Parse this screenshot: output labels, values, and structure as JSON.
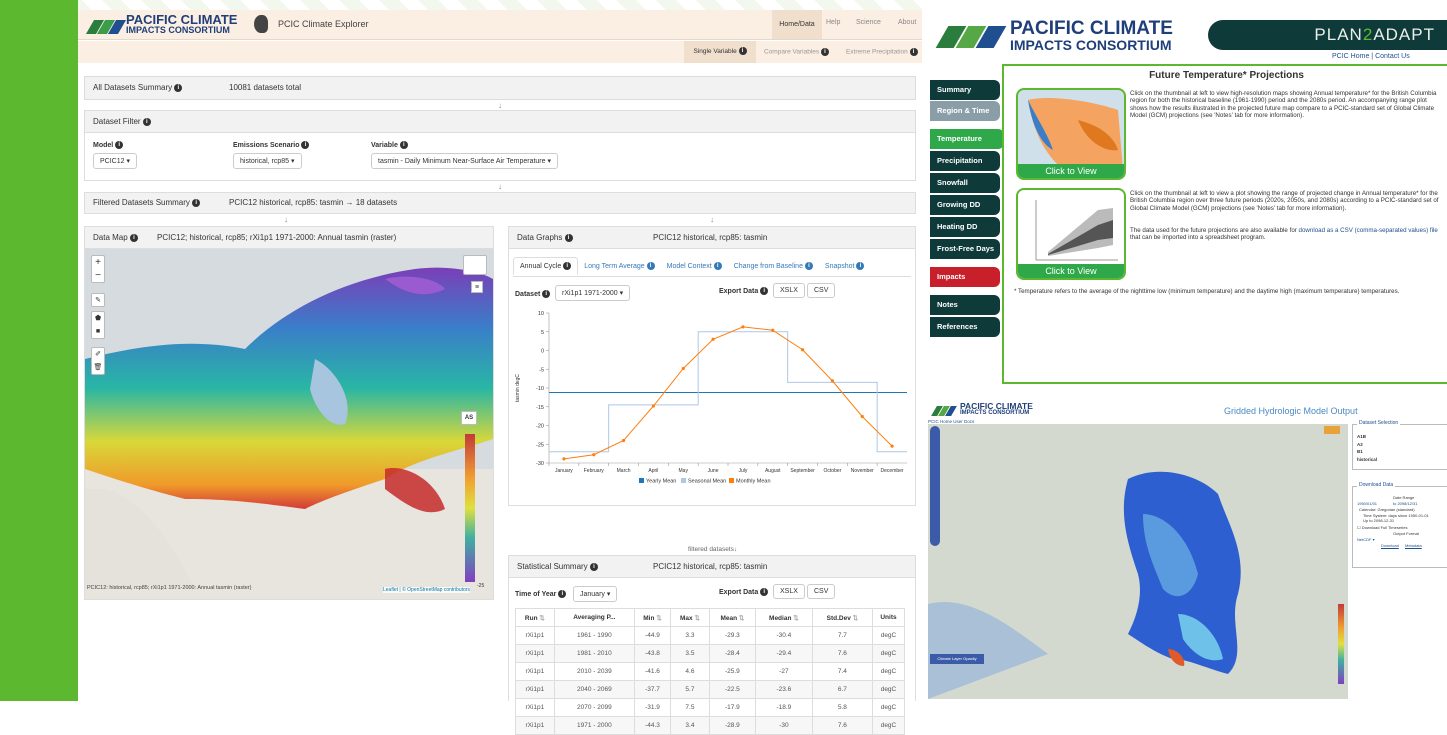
{
  "explorer": {
    "logo_line1": "PACIFIC CLIMATE",
    "logo_line2": "IMPACTS CONSORTIUM",
    "app_title": "PCIC Climate Explorer",
    "nav": [
      "Home/Data",
      "Help",
      "Science",
      "About"
    ],
    "subnav": [
      "Single Variable",
      "Compare Variables",
      "Extreme Precipitation"
    ],
    "summary_label": "All Datasets Summary",
    "summary_count": "10081 datasets total",
    "filter_label": "Dataset Filter",
    "model_label": "Model",
    "model_value": "PCIC12",
    "scenario_label": "Emissions Scenario",
    "scenario_value": "historical, rcp85",
    "variable_label": "Variable",
    "variable_value": "tasmin - Daily Minimum Near-Surface Air Temperature",
    "filtered_label": "Filtered Datasets Summary",
    "filtered_value": "PCIC12 historical, rcp85: tasmin → 18 datasets",
    "map_label": "Data Map",
    "map_title": "PCIC12; historical, rcp85; rXi1p1 1971-2000: Annual tasmin (raster)",
    "map_footer": "PCIC12: historical, rcp85; rXi1p1 1971-2000: Annual tasmin (raster)",
    "map_attrib": "Leaflet | © OpenStreetMap contributors",
    "map_as": "AS",
    "map_scale_bottom": "-25",
    "graphs_label": "Data Graphs",
    "graphs_title": "PCIC12 historical, rcp85: tasmin",
    "graph_tabs": [
      "Annual Cycle",
      "Long Term Average",
      "Model Context",
      "Change from Baseline",
      "Snapshot"
    ],
    "dataset_label": "Dataset",
    "dataset_value": "rXi1p1 1971-2000",
    "export_label": "Export Data",
    "export_xlsx": "XSLX",
    "export_csv": "CSV",
    "filtered_datasets_note": "filtered datasets",
    "stats_label": "Statistical Summary",
    "stats_title": "PCIC12 historical, rcp85: tasmin",
    "time_label": "Time of Year",
    "time_value": "January",
    "table_headers": [
      "Run",
      "Averaging P...",
      "Min",
      "Max",
      "Mean",
      "Median",
      "Std.Dev",
      "Units"
    ],
    "table_rows": [
      [
        "rXi1p1",
        "1961 - 1990",
        "-44.9",
        "3.3",
        "-29.3",
        "-30.4",
        "7.7",
        "degC"
      ],
      [
        "rXi1p1",
        "1981 - 2010",
        "-43.8",
        "3.5",
        "-28.4",
        "-29.4",
        "7.6",
        "degC"
      ],
      [
        "rXi1p1",
        "2010 - 2039",
        "-41.6",
        "4.6",
        "-25.9",
        "-27",
        "7.4",
        "degC"
      ],
      [
        "rXi1p1",
        "2040 - 2069",
        "-37.7",
        "5.7",
        "-22.5",
        "-23.6",
        "6.7",
        "degC"
      ],
      [
        "rXi1p1",
        "2070 - 2099",
        "-31.9",
        "7.5",
        "-17.9",
        "-18.9",
        "5.8",
        "degC"
      ],
      [
        "rXi1p1",
        "1971 - 2000",
        "-44.3",
        "3.4",
        "-28.9",
        "-30",
        "7.6",
        "degC"
      ]
    ]
  },
  "chart_data": {
    "type": "line",
    "ylabel": "tasmin degC",
    "ylim": [
      -30,
      10
    ],
    "yticks": [
      "10",
      "5",
      "0",
      "-5",
      "-10",
      "-15",
      "-20",
      "-25",
      "-30"
    ],
    "categories": [
      "January",
      "February",
      "March",
      "April",
      "May",
      "June",
      "July",
      "August",
      "September",
      "October",
      "November",
      "December"
    ],
    "series": [
      {
        "name": "Yearly Mean",
        "color": "#1f77b4",
        "values": [
          -11.2,
          -11.2,
          -11.2,
          -11.2,
          -11.2,
          -11.2,
          -11.2,
          -11.2,
          -11.2,
          -11.2,
          -11.2,
          -11.2
        ]
      },
      {
        "name": "Seasonal Mean",
        "color": "#aec7e8",
        "values": [
          -27.0,
          -27.0,
          -14.5,
          -14.5,
          -14.5,
          5.0,
          5.0,
          5.0,
          -8.5,
          -8.5,
          -8.5,
          -27.0
        ]
      },
      {
        "name": "Monthly Mean",
        "color": "#ff7f0e",
        "values": [
          -28.9,
          -27.8,
          -24.0,
          -14.8,
          -4.8,
          3.0,
          6.3,
          5.4,
          0.2,
          -8.1,
          -17.6,
          -25.5
        ]
      }
    ],
    "legend": "bottom"
  },
  "p2a": {
    "logo_line1": "PACIFIC CLIMATE",
    "logo_line2": "IMPACTS CONSORTIUM",
    "brand_a": "PLAN",
    "brand_2": "2",
    "brand_b": "ADAPT",
    "link_home": "PCIC Home",
    "link_sep": "|",
    "link_contact": "Contact Us",
    "nav": [
      "Summary",
      "Region & Time",
      "Temperature",
      "Precipitation",
      "Snowfall",
      "Growing DD",
      "Heating DD",
      "Frost-Free Days",
      "Impacts",
      "Notes",
      "References"
    ],
    "title": "Future Temperature* Projections",
    "click_to_view": "Click to View",
    "para1": "Click on the thumbnail at left to view high-resolution maps showing Annual temperature* for the British Columbia region for both the historical baseline (1961-1990) period and the 2080s period. An accompanying range plot shows how the results illustrated in the projected future map compare to a PCIC-standard set of Global Climate Model (GCM) projections (see 'Notes' tab for more information).",
    "para2": "Click on the thumbnail at left to view a plot showing the range of projected change in Annual temperature* for the British Columbia region over three future periods (2020s, 2050s, and 2080s) according to a PCIC-standard set of Global Climate Model (GCM) projections (see 'Notes' tab for more information).",
    "para3_a": "The data used for the future projections are also available for ",
    "para3_link": "download as a CSV (comma-separated values) file",
    "para3_b": " that can be imported into a spreadsheet program.",
    "footnote": "* Temperature refers to the average of the nighttime low (minimum temperature) and the daytime high (maximum temperature) temperatures."
  },
  "hydro": {
    "logo_line1": "PACIFIC CLIMATE",
    "logo_line2": "IMPACTS CONSORTIUM",
    "title": "Gridded Hydrologic Model Output",
    "links": "PCIC Home  User Docs",
    "dataset_selection": "Dataset Selection",
    "ds_rows": [
      "A1B",
      "A2",
      "B1",
      "historical"
    ],
    "download_data": "Download Data",
    "date_range": "Date Range",
    "date_from": "1950/01/01",
    "date_to": "to 2098/12/31",
    "calendar": "Calendar: Gregorian (standard)",
    "time_system": "Time System: days since 1950-01-01",
    "up_to": "Up to 2098-12-31",
    "download_full": "Download Full Timeseries",
    "output_format": "Output Format",
    "format_value": "NetCDF",
    "download_btn": "Download",
    "metadata_btn": "Metadata",
    "layer_opacity": "Climate Layer Opacity"
  }
}
